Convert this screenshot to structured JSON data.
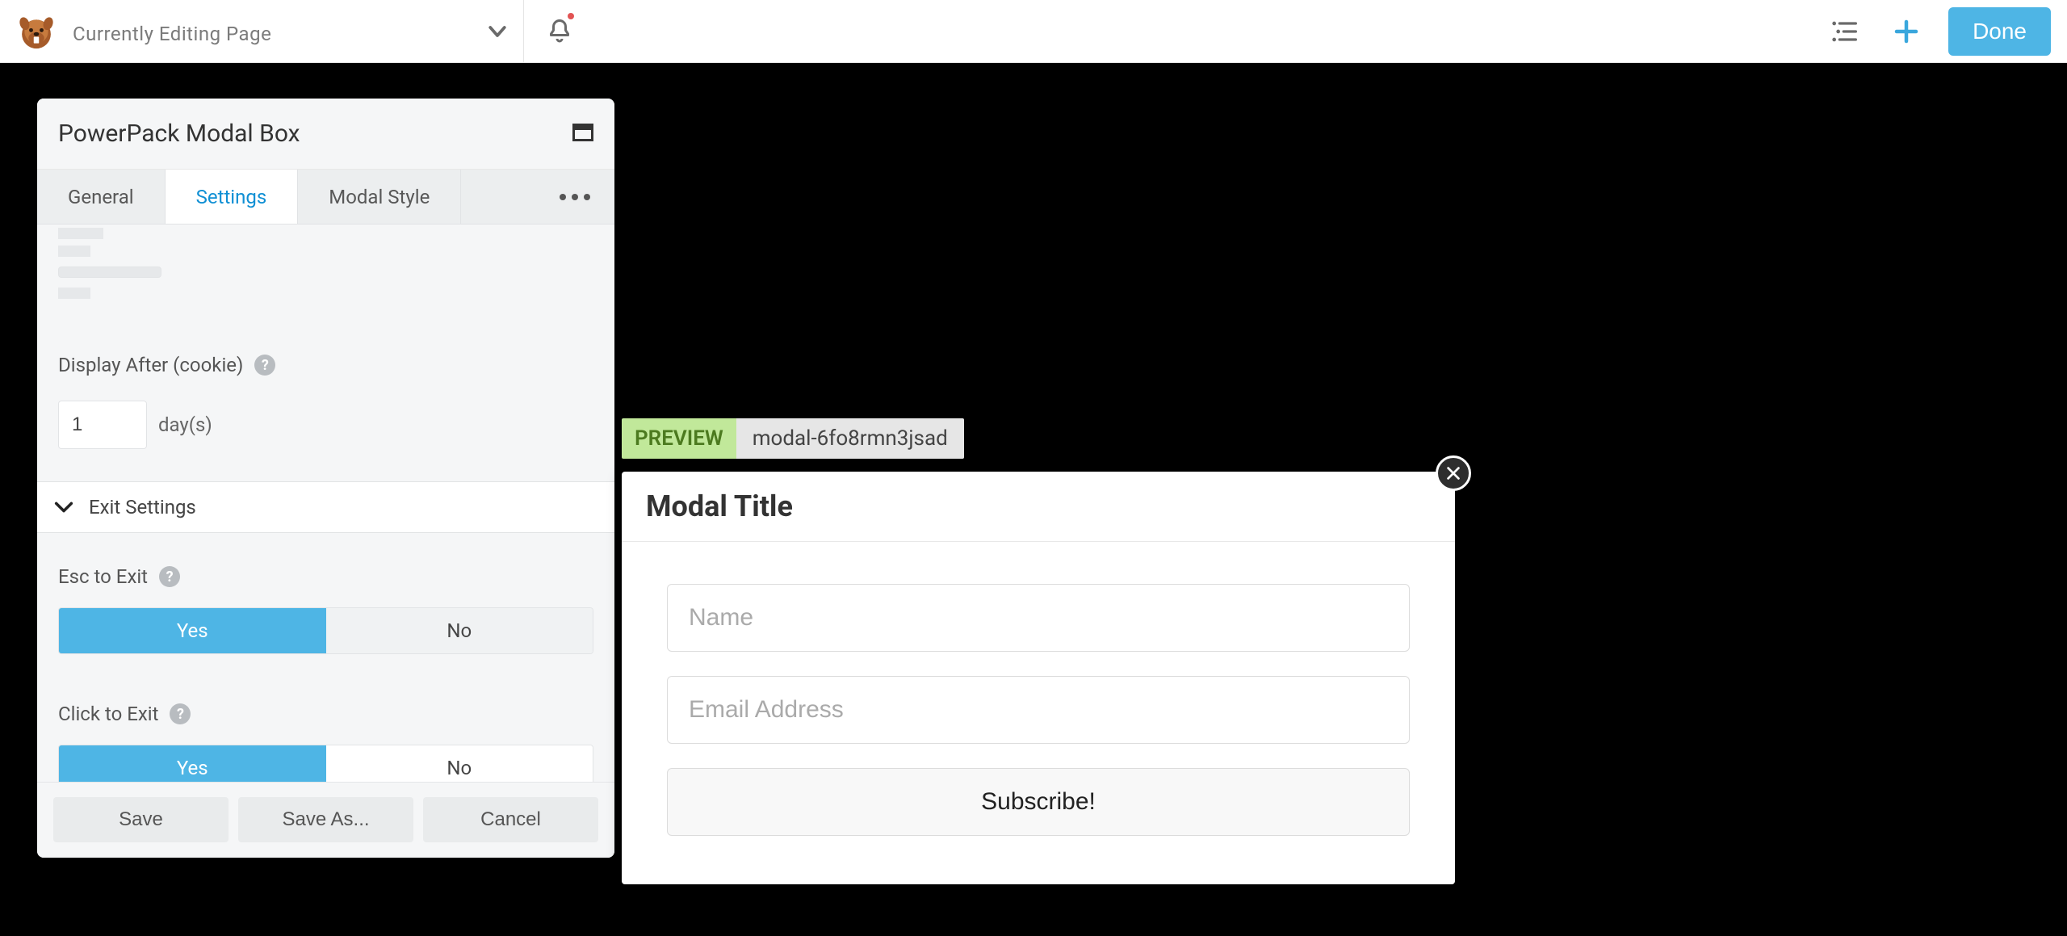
{
  "topbar": {
    "page_title": "Currently Editing Page",
    "done_label": "Done"
  },
  "panel": {
    "title": "PowerPack Modal Box",
    "tabs": {
      "general": "General",
      "settings": "Settings",
      "modal_style": "Modal Style"
    },
    "display_after": {
      "label": "Display After (cookie)",
      "value": "1",
      "unit": "day(s)"
    },
    "exit_settings_title": "Exit Settings",
    "esc_to_exit": {
      "label": "Esc to Exit",
      "yes": "Yes",
      "no": "No"
    },
    "click_to_exit": {
      "label": "Click to Exit",
      "yes": "Yes",
      "no": "No"
    },
    "footer": {
      "save": "Save",
      "save_as": "Save As...",
      "cancel": "Cancel"
    }
  },
  "preview": {
    "badge": "PREVIEW",
    "id": "modal-6fo8rmn3jsad",
    "modal_title": "Modal Title",
    "name_placeholder": "Name",
    "email_placeholder": "Email Address",
    "subscribe_label": "Subscribe!"
  }
}
